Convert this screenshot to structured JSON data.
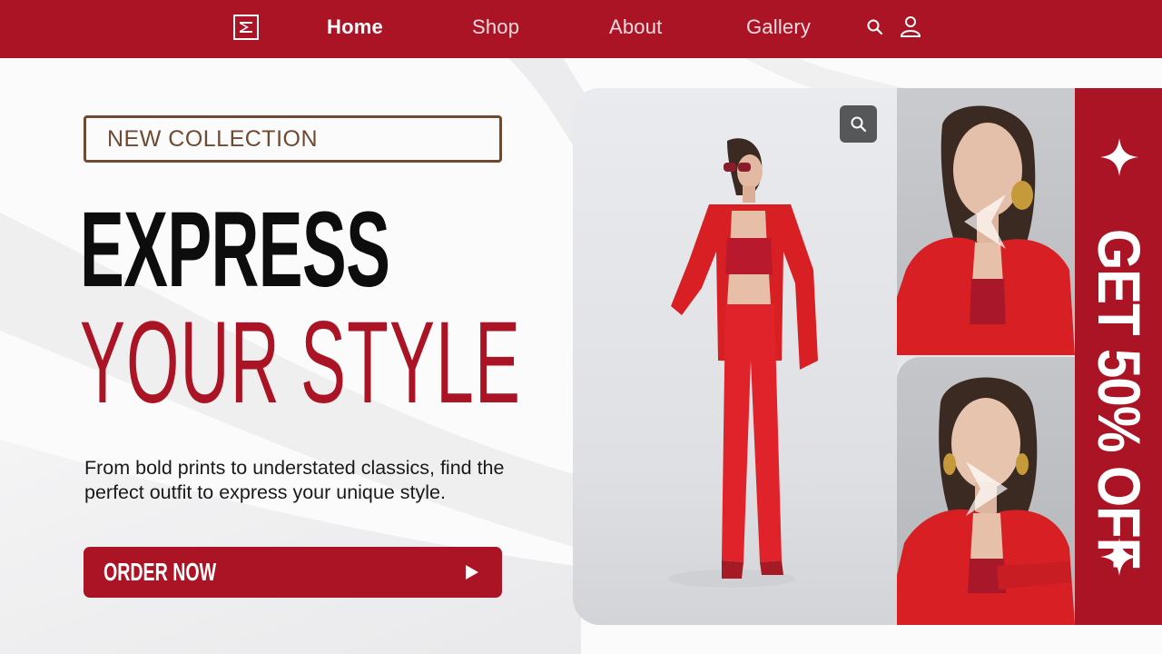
{
  "nav": {
    "items": [
      {
        "label": "Home",
        "active": true
      },
      {
        "label": "Shop",
        "active": false
      },
      {
        "label": "About",
        "active": false
      },
      {
        "label": "Gallery",
        "active": false
      }
    ],
    "icons": [
      "logo-icon",
      "search-icon",
      "user-icon"
    ]
  },
  "hero": {
    "tag": "NEW COLLECTION",
    "headline_line1": "EXPRESS",
    "headline_line2": "YOUR STYLE",
    "description": "From bold prints to understated classics, find the perfect outfit to express your unique style.",
    "cta_label": "ORDER NOW"
  },
  "promo": {
    "text": "GET 50% OFF"
  },
  "colors": {
    "brand_red": "#ab1424",
    "tag_brown": "#6e4a33",
    "headline_black": "#0d0d0d",
    "zoom_button": "#565759"
  }
}
